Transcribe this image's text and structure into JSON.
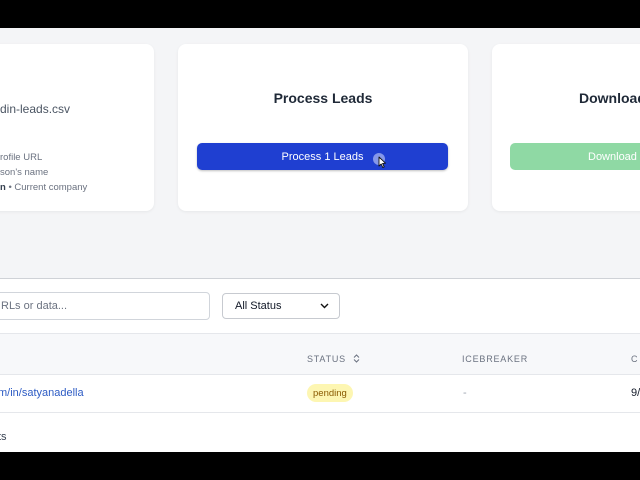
{
  "upload_card": {
    "filename": "din-leads.csv",
    "requirements": [
      "rofile URL",
      "son's name"
    ],
    "requirement_3_bold": "n",
    "requirement_3_rest": " • Current company"
  },
  "process_card": {
    "title": "Process Leads",
    "button_label": "Process 1 Leads",
    "button_color": "#1f3fd1"
  },
  "download_card": {
    "title": "Download",
    "button_label": "Download",
    "button_color": "#8fd9a4"
  },
  "filters": {
    "search_placeholder": "RLs or data...",
    "status_selected": "All Status"
  },
  "table": {
    "headers": {
      "status": "STATUS",
      "icebreaker": "ICEBREAKER",
      "col4": "C"
    },
    "rows": [
      {
        "url": "m/in/satyanadella",
        "status": "pending",
        "icebreaker": "-",
        "col4": "9/"
      }
    ]
  },
  "footer": {
    "text": "ts"
  },
  "icons": [
    "sort-icon",
    "chevron-down-icon",
    "pointer-cursor-icon"
  ]
}
